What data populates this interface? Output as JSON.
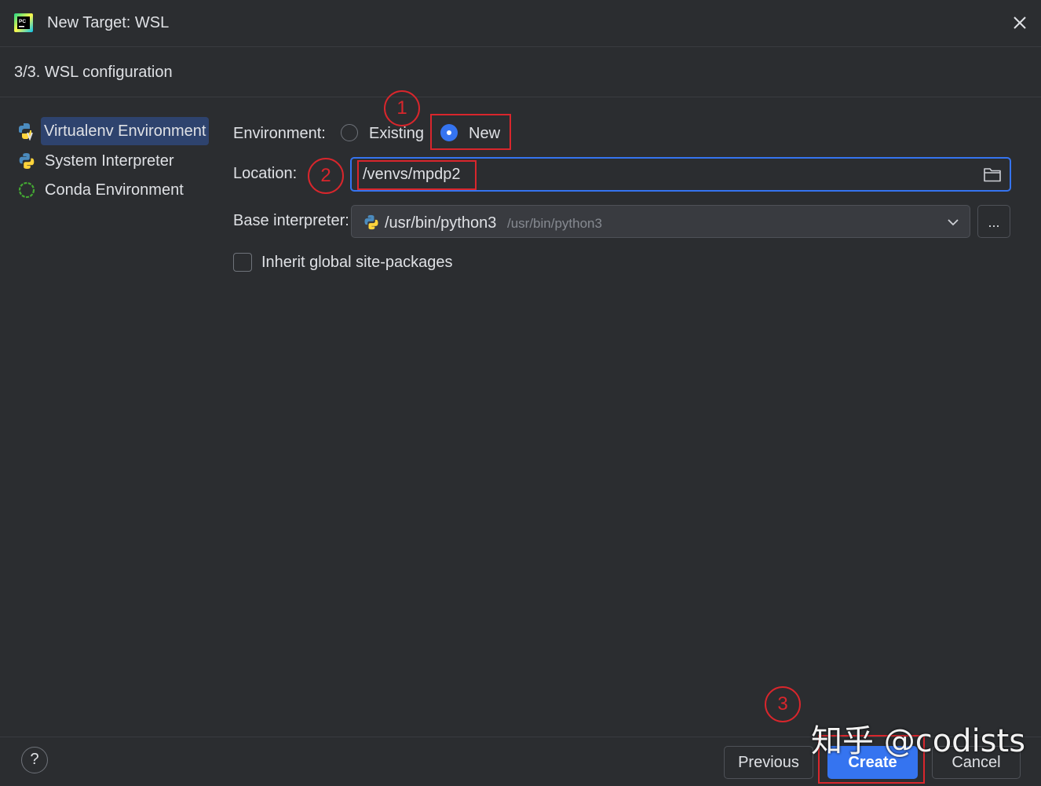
{
  "window": {
    "title": "New Target: WSL",
    "step": "3/3. WSL configuration"
  },
  "sidebar": {
    "items": [
      {
        "label": "Virtualenv Environment",
        "icon": "virtualenv-icon",
        "selected": true
      },
      {
        "label": "System Interpreter",
        "icon": "python-icon",
        "selected": false
      },
      {
        "label": "Conda Environment",
        "icon": "conda-icon",
        "selected": false
      }
    ]
  },
  "form": {
    "environment_label": "Environment:",
    "existing_label": "Existing",
    "new_label": "New",
    "selected_environment": "New",
    "location_label": "Location:",
    "location_value": "/venvs/mpdp2",
    "base_interpreter_label": "Base interpreter:",
    "interpreter_value": "/usr/bin/python3",
    "interpreter_path_hint": "/usr/bin/python3",
    "browse_label": "...",
    "inherit_label": "Inherit global site-packages",
    "inherit_checked": false
  },
  "annotations": {
    "step1": "1",
    "step2": "2",
    "step3": "3"
  },
  "footer": {
    "help_label": "?",
    "previous_label": "Previous",
    "create_label": "Create",
    "cancel_label": "Cancel"
  },
  "watermark": "知乎 @codists",
  "colors": {
    "background": "#2b2d30",
    "accent": "#3574f0",
    "selection": "#2e436e",
    "annotation": "#d9262c"
  }
}
